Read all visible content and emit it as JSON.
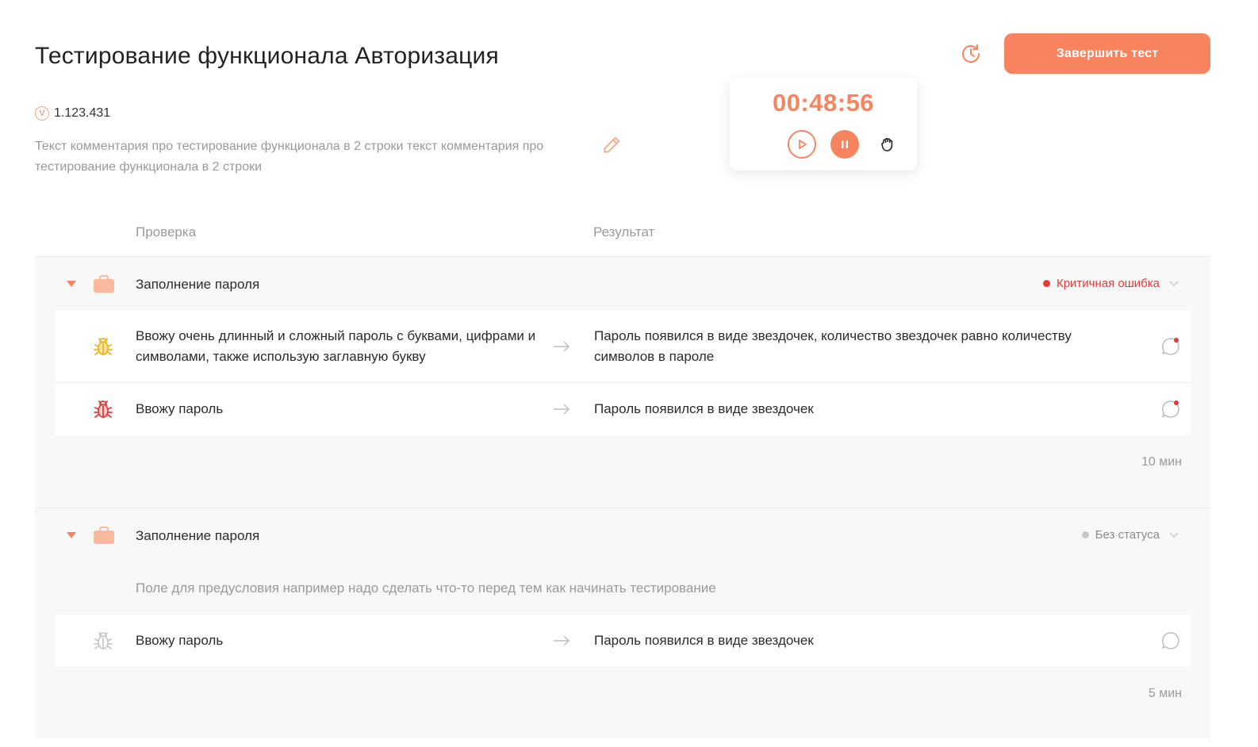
{
  "header": {
    "title": "Тестирование функционала  Авторизация",
    "version": "1.123.431",
    "version_icon": "version-badge-icon",
    "comment": "Текст комментария про тестирование функционала в 2 строки текст комментария про тестирование функционала в 2 строки",
    "finish_label": "Завершить тест"
  },
  "timer": {
    "value": "00:48:56"
  },
  "columns": {
    "check": "Проверка",
    "result": "Результат"
  },
  "colors": {
    "accent": "#f7845e",
    "critical": "#e53935",
    "neutral": "#c8c8c8",
    "bug_yellow": "#f2b21b",
    "bug_red": "#e53935"
  },
  "groups": [
    {
      "title": "Заполнение пароля",
      "status": "Критичная ошибка",
      "duration": "10 мин",
      "steps": [
        {
          "check": "Ввожу очень длинный и сложный пароль с буквами, цифрами и символами, также использую заглавную букву",
          "result": "Пароль появился в виде звездочек, количество звездочек равно количеству символов в пароле",
          "bug": "bug-yellow-icon"
        },
        {
          "check": "Ввожу пароль",
          "result": "Пароль появился в виде звездочек",
          "bug": "bug-red-icon"
        }
      ]
    },
    {
      "title": "Заполнение пароля",
      "status": "Без статуса",
      "precondition": "Поле для предусловия например надо сделать что-то перед тем как начинать тестирование",
      "duration": "5 мин",
      "steps": [
        {
          "check": "Ввожу пароль",
          "result": "Пароль появился в виде звездочек",
          "bug": "bug-gray-icon"
        }
      ]
    }
  ]
}
